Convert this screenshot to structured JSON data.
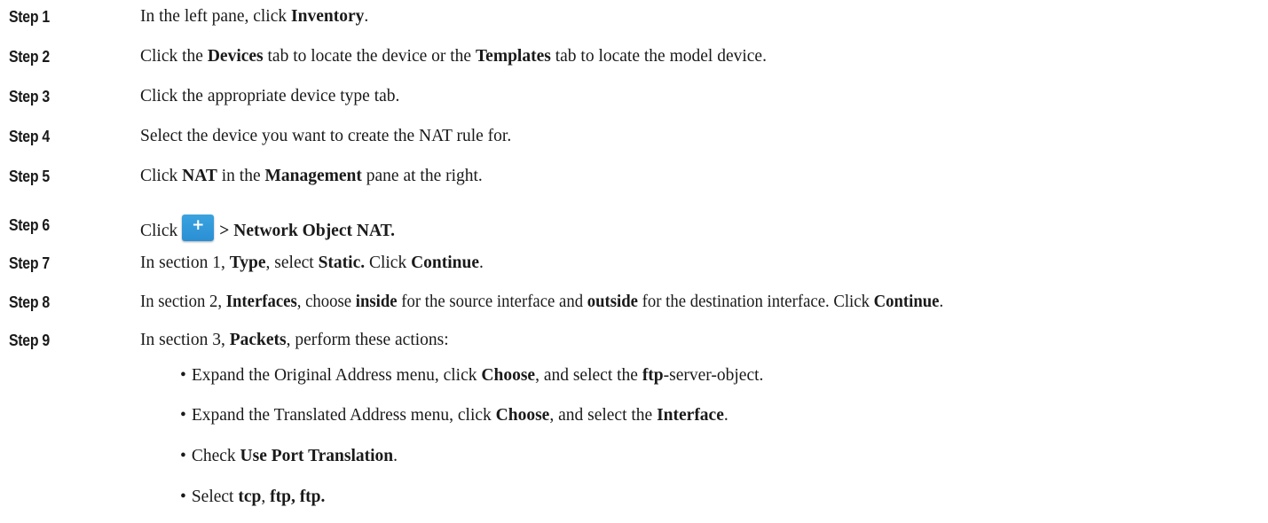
{
  "steps": [
    {
      "label": "Step 1",
      "parts": [
        {
          "t": "In the left pane, click "
        },
        {
          "t": "Inventory",
          "b": true
        },
        {
          "t": "."
        }
      ]
    },
    {
      "label": "Step 2",
      "parts": [
        {
          "t": "Click the "
        },
        {
          "t": "Devices",
          "b": true
        },
        {
          "t": " tab to locate the device or the "
        },
        {
          "t": "Templates",
          "b": true
        },
        {
          "t": " tab to locate the model device."
        }
      ]
    },
    {
      "label": "Step 3",
      "parts": [
        {
          "t": "Click the appropriate device type tab."
        }
      ]
    },
    {
      "label": "Step 4",
      "parts": [
        {
          "t": "Select the device you want to create the NAT rule for."
        }
      ]
    },
    {
      "label": "Step 5",
      "parts": [
        {
          "t": "Click "
        },
        {
          "t": "NAT",
          "b": true
        },
        {
          "t": " in the "
        },
        {
          "t": "Management",
          "b": true
        },
        {
          "t": " pane at the right."
        }
      ]
    },
    {
      "label": "Step 6",
      "parts": [
        {
          "t": "Click"
        },
        {
          "icon": "add-plus-icon"
        },
        {
          "t": "> Network Object NAT.",
          "b": true
        }
      ]
    },
    {
      "label": "Step 7",
      "parts": [
        {
          "t": "In section 1, "
        },
        {
          "t": "Type",
          "b": true
        },
        {
          "t": ", select "
        },
        {
          "t": "Static.",
          "b": true
        },
        {
          "t": " Click "
        },
        {
          "t": "Continue",
          "b": true
        },
        {
          "t": "."
        }
      ]
    },
    {
      "label": "Step 8",
      "parts": [
        {
          "t": "In section 2, "
        },
        {
          "t": "Interfaces",
          "b": true
        },
        {
          "t": ", choose "
        },
        {
          "t": "inside",
          "b": true
        },
        {
          "t": " for the source interface and "
        },
        {
          "t": "outside",
          "b": true
        },
        {
          "t": " for the destination interface. Click "
        },
        {
          "t": "Continue",
          "b": true
        },
        {
          "t": "."
        }
      ]
    },
    {
      "label": "Step 9",
      "parts": [
        {
          "t": "In section 3, "
        },
        {
          "t": "Packets",
          "b": true
        },
        {
          "t": ", perform these actions:"
        }
      ]
    }
  ],
  "bullets": [
    {
      "parts": [
        {
          "t": "Expand the Original Address menu, click "
        },
        {
          "t": "Choose",
          "b": true
        },
        {
          "t": ", and select the "
        },
        {
          "t": "ftp",
          "b": true
        },
        {
          "t": "-server-object."
        }
      ]
    },
    {
      "parts": [
        {
          "t": "Expand the Translated Address menu, click "
        },
        {
          "t": "Choose",
          "b": true
        },
        {
          "t": ", and select the "
        },
        {
          "t": "Interface",
          "b": true
        },
        {
          "t": "."
        }
      ]
    },
    {
      "parts": [
        {
          "t": "Check "
        },
        {
          "t": "Use Port Translation",
          "b": true
        },
        {
          "t": "."
        }
      ]
    },
    {
      "parts": [
        {
          "t": "Select "
        },
        {
          "t": "tcp",
          "b": true
        },
        {
          "t": ", "
        },
        {
          "t": "ftp, ftp.",
          "b": true
        }
      ]
    }
  ],
  "bullet_char": "•",
  "icon_glyph": "+",
  "colors": {
    "icon_accent": "#2a8fd4",
    "text": "#1a1a1a"
  }
}
